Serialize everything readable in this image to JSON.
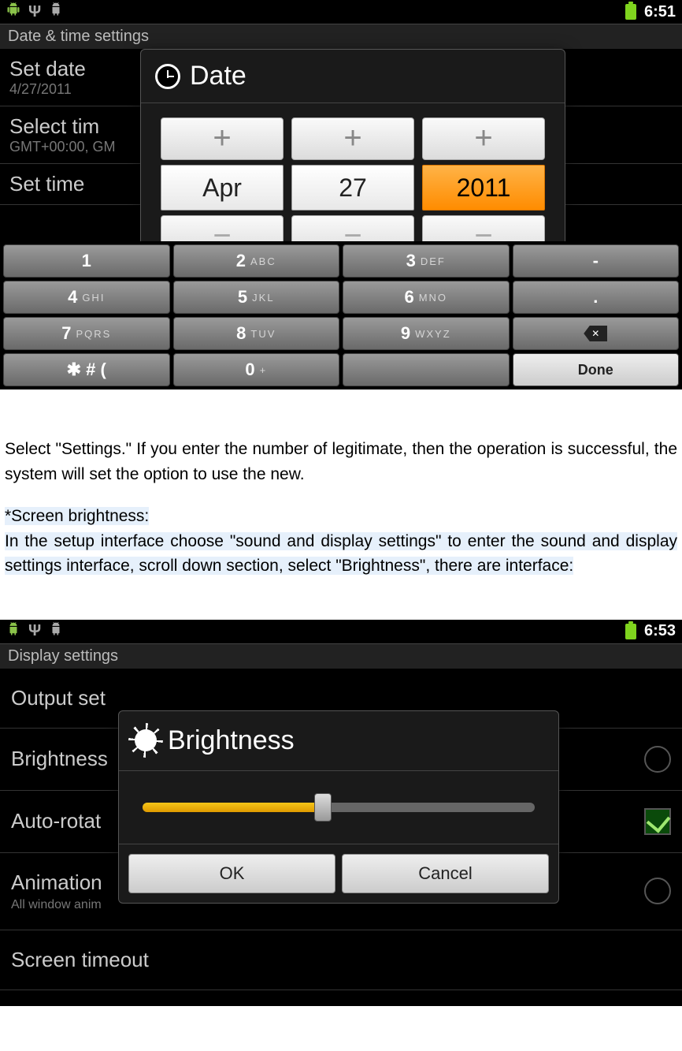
{
  "screenshot1": {
    "time": "6:51",
    "header": "Date & time settings",
    "list": {
      "set_date_label": "Set date",
      "set_date_value": "4/27/2011",
      "select_tz_label": "Select tim",
      "select_tz_value": "GMT+00:00, GM",
      "set_time_label": "Set time"
    },
    "dialog_title": "Date",
    "picker": {
      "month": "Apr",
      "day": "27",
      "year": "2011"
    },
    "keypad": {
      "k1": "1",
      "k2": "2",
      "k2l": "ABC",
      "k3": "3",
      "k3l": "DEF",
      "kdash": "-",
      "k4": "4",
      "k4l": "GHI",
      "k5": "5",
      "k5l": "JKL",
      "k6": "6",
      "k6l": "MNO",
      "kdot": ".",
      "k7": "7",
      "k7l": "PQRS",
      "k8": "8",
      "k8l": "TUV",
      "k9": "9",
      "k9l": "WXYZ",
      "ksym": "✱ # (",
      "k0": "0",
      "k0l": "+",
      "done": "Done"
    }
  },
  "doc": {
    "p1": "Select \"Settings.\" If you enter the number of legitimate, then the operation is successful, the system will set the option to use the new.",
    "h1": "*Screen brightness:",
    "p2": "In the setup interface choose \"sound and display settings\" to enter the sound and display settings interface, scroll down section, select \"Brightness\", there are interface:"
  },
  "screenshot2": {
    "time": "6:53",
    "header": "Display settings",
    "items": {
      "output": "Output set",
      "brightness": "Brightness",
      "autorotate": "Auto-rotat",
      "animation": "Animation",
      "animation_sub": "All window anim",
      "timeout": "Screen timeout"
    },
    "dialog_title": "Brightness",
    "ok": "OK",
    "cancel": "Cancel",
    "slider_percent": 46
  }
}
